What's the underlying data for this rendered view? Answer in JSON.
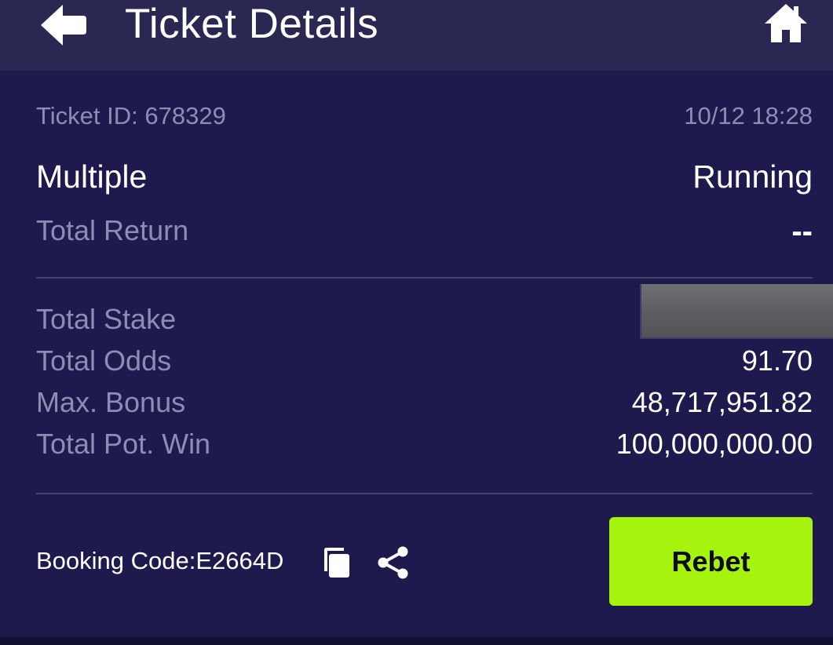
{
  "header": {
    "title": "Ticket Details",
    "back_icon": "arrow-left-icon",
    "home_icon": "home-icon"
  },
  "ticket": {
    "id_label": "Ticket ID: 678329",
    "datetime": "10/12 18:28",
    "bet_type": "Multiple",
    "status": "Running",
    "total_return_label": "Total Return",
    "total_return_value": "--"
  },
  "summary": {
    "total_stake_label": "Total Stake",
    "total_odds_label": "Total Odds",
    "total_odds_value": "91.70",
    "max_bonus_label": "Max. Bonus",
    "max_bonus_value": "48,717,951.82",
    "total_pot_win_label": "Total Pot. Win",
    "total_pot_win_value": "100,000,000.00"
  },
  "booking": {
    "code_text": "Booking Code:E2664D",
    "copy_icon": "copy-icon",
    "share_icon": "share-icon"
  },
  "actions": {
    "rebet_label": "Rebet"
  },
  "colors": {
    "background": "#1f1a4d",
    "header_background": "#2a2752",
    "muted_text": "#8e8cb3",
    "accent_button": "#a6f40e"
  }
}
